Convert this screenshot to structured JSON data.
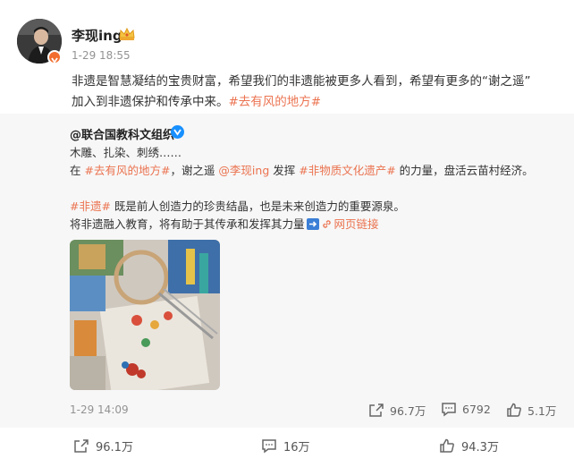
{
  "post": {
    "author": "李现ing",
    "time": "1-29 18:55",
    "text_line1": "非遗是智慧凝结的宝贵财富，希望我们的非遗能被更多人看到，希望有更多的“谢之遥”",
    "text_line2_prefix": "加入到非遗保护和传承中来。",
    "hashtag": "#去有风的地方#"
  },
  "repost": {
    "author": "@联合国教科文组织",
    "line1": "木雕、扎染、刺绣……",
    "line2_a": "在 ",
    "line2_tag": "#去有风的地方#",
    "line2_b": "，谢之遥 ",
    "line2_mention": "@李现ing",
    "line2_c": " 发挥 ",
    "line2_tag2": "#非物质文化遗产#",
    "line2_d": " 的力量，盘活云苗村经济。",
    "line3_tag": "#非遗#",
    "line3_text": " 既是前人创造力的珍贵结晶，也是未来创造力的重要源泉。",
    "line4_text": "将非遗融入教育，将有助于其传承和发挥其力量",
    "web_link": "网页链接",
    "time": "1-29 14:09",
    "shares": "96.7万",
    "comments": "6792",
    "likes": "5.1万"
  },
  "actions": {
    "shares": "96.1万",
    "comments": "16万",
    "likes": "94.3万"
  },
  "colors": {
    "accent": "#eb7350",
    "verified": "#1890ff"
  }
}
